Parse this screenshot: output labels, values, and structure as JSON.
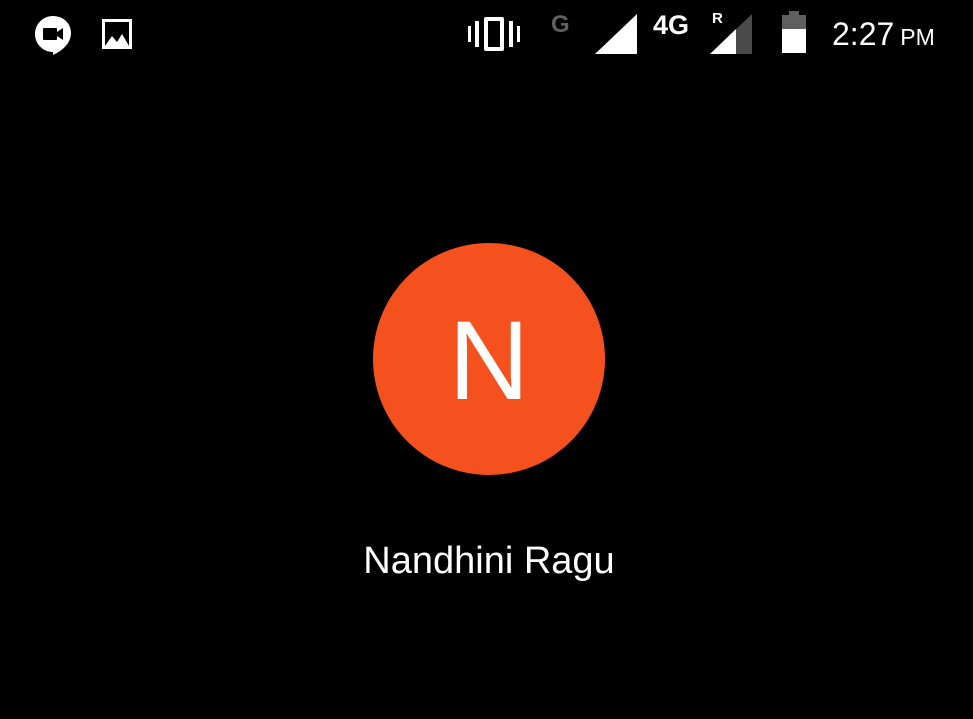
{
  "status_bar": {
    "icons": [
      "hangouts-icon",
      "gallery-icon",
      "vibrate-icon",
      "signal-icon",
      "signal-roaming-icon",
      "battery-icon"
    ],
    "network_g": "G",
    "network_type": "4G",
    "roaming_indicator": "R",
    "time": "2:27",
    "ampm": "PM"
  },
  "contact": {
    "initial": "N",
    "name": "Nandhini Ragu",
    "avatar_color": "#f4511e"
  },
  "colors": {
    "background": "#000000",
    "text": "#ffffff",
    "muted": "#5f5f5f"
  }
}
